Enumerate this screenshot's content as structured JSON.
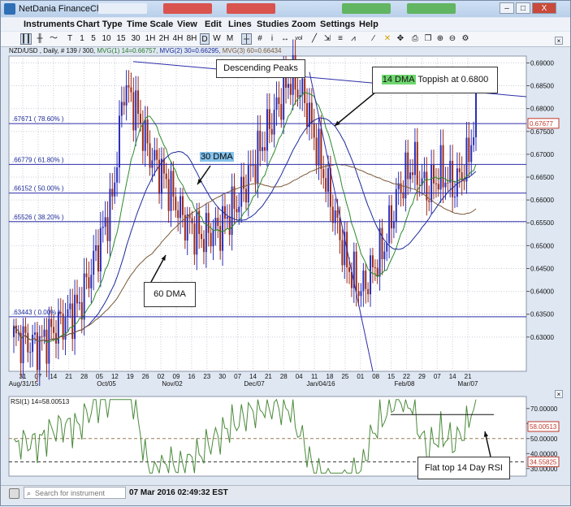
{
  "window": {
    "title": "NetDania FinanceChart",
    "controls": [
      "–",
      "□",
      "X"
    ]
  },
  "menu": [
    "Instruments",
    "Chart Type",
    "Time Scale",
    "View",
    "Edit",
    "Lines",
    "Studies",
    "Zoom",
    "Settings",
    "Help"
  ],
  "toolbar": {
    "intervals": [
      "T",
      "1",
      "5",
      "10",
      "15",
      "30",
      "1H",
      "2H",
      "4H",
      "8H",
      "D",
      "W",
      "M"
    ],
    "selected_interval": "D"
  },
  "legend": {
    "symbol": "NZD/USD , Daily, # 139 / 300,",
    "mvg1": "MVG(1) 14=0.66757,",
    "mvg2": "MVG(2) 30=0.66295,",
    "mvg3": "MVG(3) 60=0.66434"
  },
  "colors": {
    "bull": "#2b2fb8",
    "bear": "#9b2a1a",
    "mvg14": "#2c8a2c",
    "mvg30": "#1d2b9a",
    "mvg60": "#7a5a3a",
    "fib_line": "#2d2da8",
    "rsi": "#4a8a3a"
  },
  "price_axis": [
    "0.69000",
    "0.68500",
    "0.68000",
    "0.67500",
    "0.67000",
    "0.66500",
    "0.66000",
    "0.65500",
    "0.65000",
    "0.64500",
    "0.64000",
    "0.63500",
    "0.63000"
  ],
  "current_price": "0.67677",
  "fib_levels": [
    {
      "label": ".67671 ( 78.60% )",
      "value": 0.67671
    },
    {
      "label": ".66779 ( 61.80% )",
      "value": 0.66779
    },
    {
      "label": ".66152 ( 50.00% )",
      "value": 0.66152
    },
    {
      "label": ".65526 ( 38.20% )",
      "value": 0.65526
    },
    {
      "label": ".63443 ( 0.00% )",
      "value": 0.63443
    }
  ],
  "date_axis": {
    "days": [
      "31",
      "07",
      "14",
      "21",
      "28",
      "05",
      "12",
      "19",
      "26",
      "02",
      "09",
      "16",
      "23",
      "30",
      "07",
      "14",
      "21",
      "28",
      "04",
      "11",
      "18",
      "25",
      "01",
      "08",
      "15",
      "22",
      "29",
      "07",
      "14",
      "21"
    ],
    "months": [
      "Aug/31/15",
      "Oct/05",
      "Nov/02",
      "Dec/07",
      "Jan/04/16",
      "Feb/08",
      "Mar/07"
    ]
  },
  "rsi": {
    "label": "RSI(1) 14=58.00513",
    "axis": [
      "70.00000",
      "60.00000",
      "50.00000",
      "40.00000",
      "30.00000"
    ],
    "current": "58.00513",
    "level_low": "34.55825"
  },
  "annotations": {
    "descending_peaks": "Descending Peaks",
    "dma14_tag": "14 DMA",
    "dma14_text": " Toppish at 0.6800",
    "dma30_tag": "30 DMA",
    "dma60": "60 DMA",
    "rsi_note": "Flat top 14 Day RSI"
  },
  "status": {
    "search_placeholder": "Search for instrument",
    "datetime": "07 Mar 2016 02:49:32 EST"
  }
}
